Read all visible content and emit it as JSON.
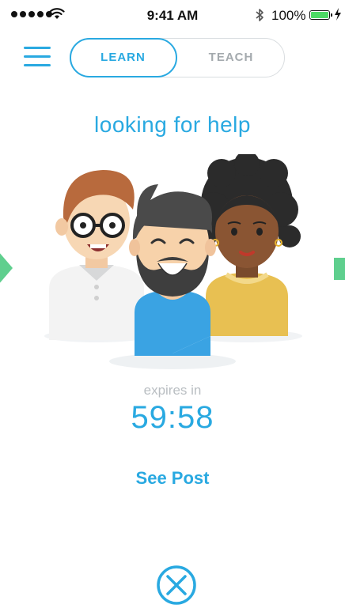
{
  "status_bar": {
    "time": "9:41 AM",
    "battery_percent": "100%",
    "signal_bars": 5,
    "battery_color": "#4cd964"
  },
  "nav": {
    "menu_icon": "hamburger-icon",
    "tabs": [
      {
        "label": "LEARN",
        "selected": true
      },
      {
        "label": "TEACH",
        "selected": false
      }
    ]
  },
  "main": {
    "title": "looking for help",
    "expires_label": "expires in",
    "countdown": "59:58",
    "see_post_label": "See Post",
    "illustration_icon": "group-of-people-illustration",
    "close_icon": "close-circle-icon"
  },
  "colors": {
    "accent": "#29a9e1",
    "muted": "#a4aaae",
    "arrow_green": "#5fcf8e"
  }
}
